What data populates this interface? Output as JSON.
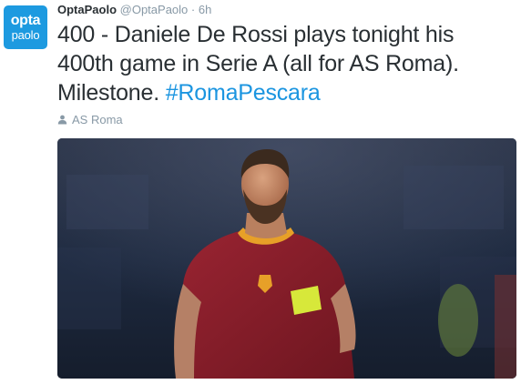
{
  "author": {
    "name": "OptaPaolo",
    "handle": "@OptaPaolo",
    "separator": "·",
    "time": "6h",
    "avatar_line1": "opta",
    "avatar_line2": "paolo"
  },
  "tweet": {
    "text": "400 - Daniele De Rossi plays tonight his 400th game in Serie A (all for AS Roma). Milestone. ",
    "hashtag": "#RomaPescara"
  },
  "location": {
    "icon": "person-icon",
    "label": "AS Roma"
  },
  "media": {
    "kind": "photo",
    "colors": {
      "jersey": "#8a1f2a",
      "collar": "#e7a028",
      "armband": "#d7e83a",
      "background": "#1a2436"
    }
  },
  "colors": {
    "brand": "#1d9ae0",
    "link": "#1b95e0",
    "text": "#292f33",
    "meta": "#8899a6"
  }
}
